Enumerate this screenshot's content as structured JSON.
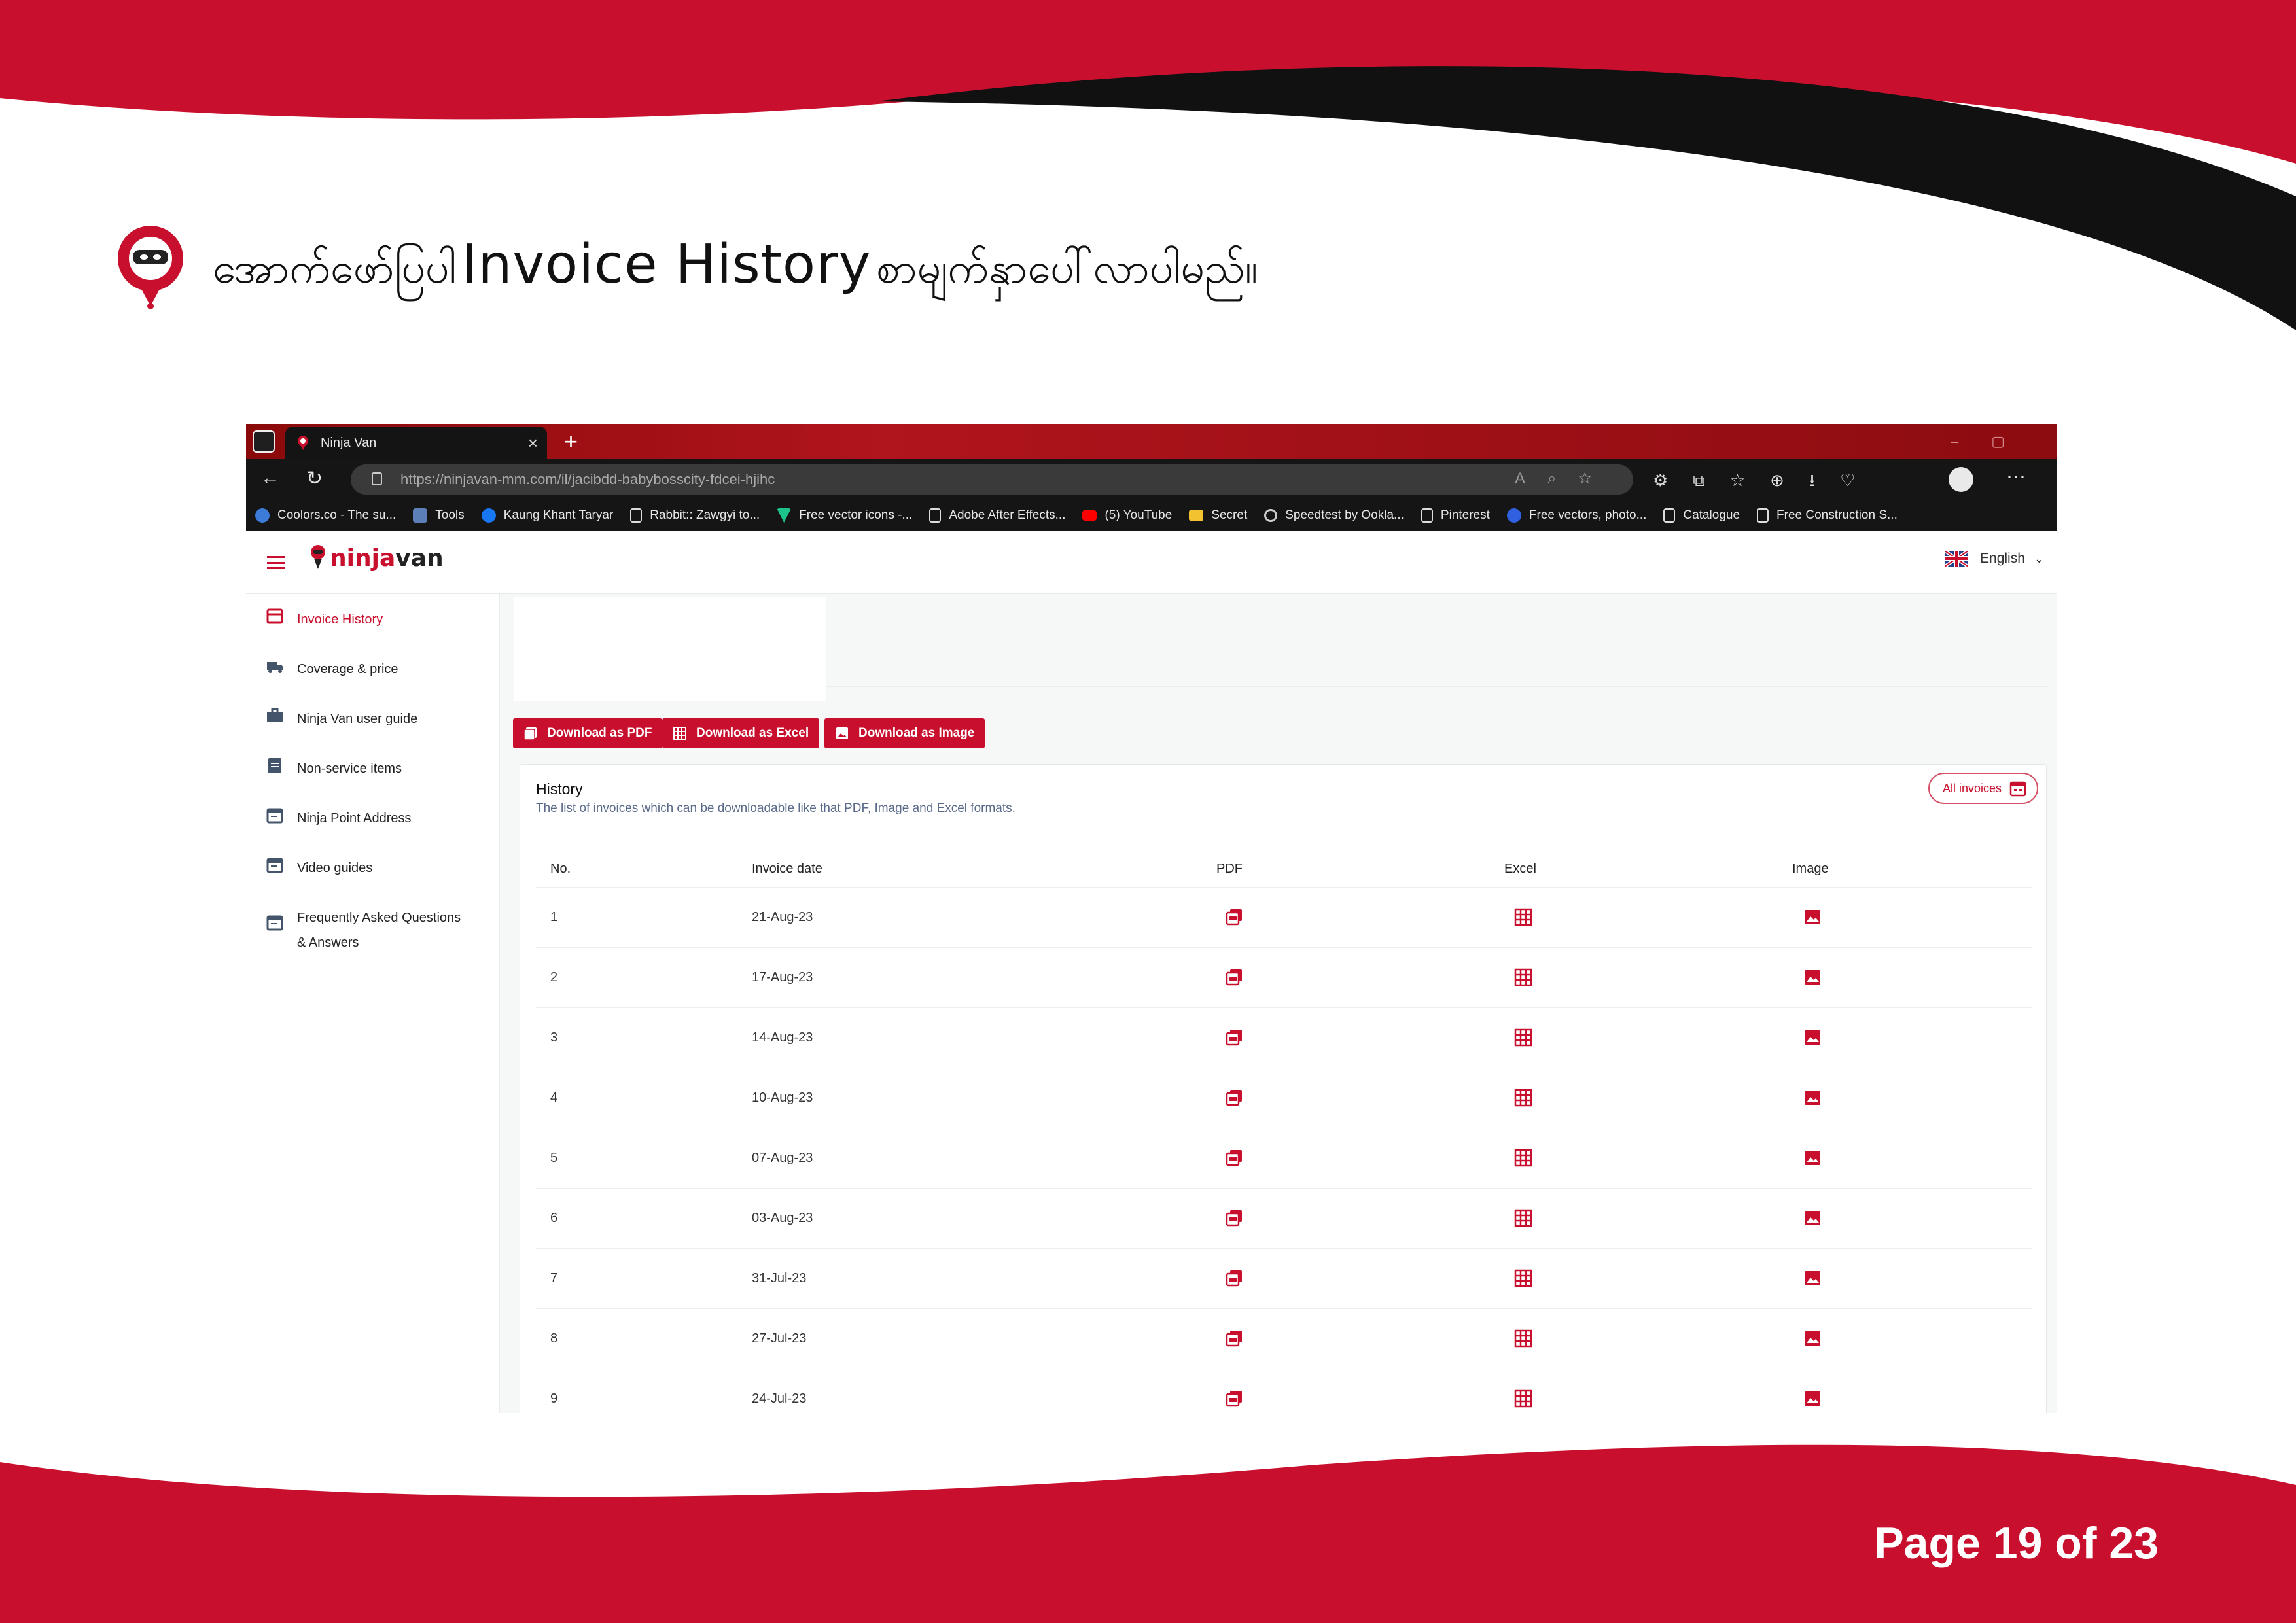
{
  "slide": {
    "heading_my_before": "အောက်ဖော်ပြပါ",
    "heading_en": "Invoice History",
    "heading_my_after": "စာမျက်နှာပေါ်လာပါမည်။",
    "page_label": "Page 19 of 23",
    "colors": {
      "brand_red": "#c8102e",
      "swoosh_black": "#111111"
    }
  },
  "browser": {
    "tab_title": "Ninja Van",
    "url": "https://ninjavan-mm.com/il/jacibdd-babybosscity-fdcei-hjihc",
    "bookmarks": [
      {
        "label": "Coolors.co - The su...",
        "icon": "coolors-icon"
      },
      {
        "label": "Tools",
        "icon": "folder-icon"
      },
      {
        "label": "Kaung Khant Taryar",
        "icon": "facebook-icon"
      },
      {
        "label": "Rabbit:: Zawgyi to...",
        "icon": "page-icon"
      },
      {
        "label": "Free vector icons -...",
        "icon": "flaticon-icon"
      },
      {
        "label": "Adobe After Effects...",
        "icon": "page-icon"
      },
      {
        "label": "(5) YouTube",
        "icon": "youtube-icon"
      },
      {
        "label": "Secret",
        "icon": "folder-icon"
      },
      {
        "label": "Speedtest by Ookla...",
        "icon": "speedtest-icon"
      },
      {
        "label": "Pinterest",
        "icon": "page-icon"
      },
      {
        "label": "Free vectors, photo...",
        "icon": "freepik-icon"
      },
      {
        "label": "Catalogue",
        "icon": "page-icon"
      },
      {
        "label": "Free Construction S...",
        "icon": "page-icon"
      }
    ]
  },
  "app": {
    "logo_ninja": "ninja",
    "logo_van": "van",
    "language": "English",
    "sidebar": [
      {
        "label": "Invoice History",
        "icon": "storefront-icon",
        "active": true
      },
      {
        "label": "Coverage & price",
        "icon": "truck-icon",
        "active": false
      },
      {
        "label": "Ninja Van user guide",
        "icon": "briefcase-icon",
        "active": false
      },
      {
        "label": "Non-service items",
        "icon": "clipboard-icon",
        "active": false
      },
      {
        "label": "Ninja Point Address",
        "icon": "calendar-icon",
        "active": false
      },
      {
        "label": "Video guides",
        "icon": "calendar-icon",
        "active": false
      },
      {
        "label": "Frequently Asked Questions",
        "label2": "& Answers",
        "icon": "calendar-icon",
        "active": false
      }
    ],
    "buttons": {
      "pdf": "Download as PDF",
      "excel": "Download as Excel",
      "image": "Download as Image"
    },
    "history": {
      "title": "History",
      "subtitle": "The list of invoices which can be downloadable like that PDF, Image and Excel formats.",
      "all_invoices": "All invoices",
      "columns": [
        "No.",
        "Invoice date",
        "PDF",
        "Excel",
        "Image"
      ],
      "rows": [
        {
          "no": "1",
          "date": "21-Aug-23"
        },
        {
          "no": "2",
          "date": "17-Aug-23"
        },
        {
          "no": "3",
          "date": "14-Aug-23"
        },
        {
          "no": "4",
          "date": "10-Aug-23"
        },
        {
          "no": "5",
          "date": "07-Aug-23"
        },
        {
          "no": "6",
          "date": "03-Aug-23"
        },
        {
          "no": "7",
          "date": "31-Jul-23"
        },
        {
          "no": "8",
          "date": "27-Jul-23"
        },
        {
          "no": "9",
          "date": "24-Jul-23"
        }
      ]
    }
  }
}
